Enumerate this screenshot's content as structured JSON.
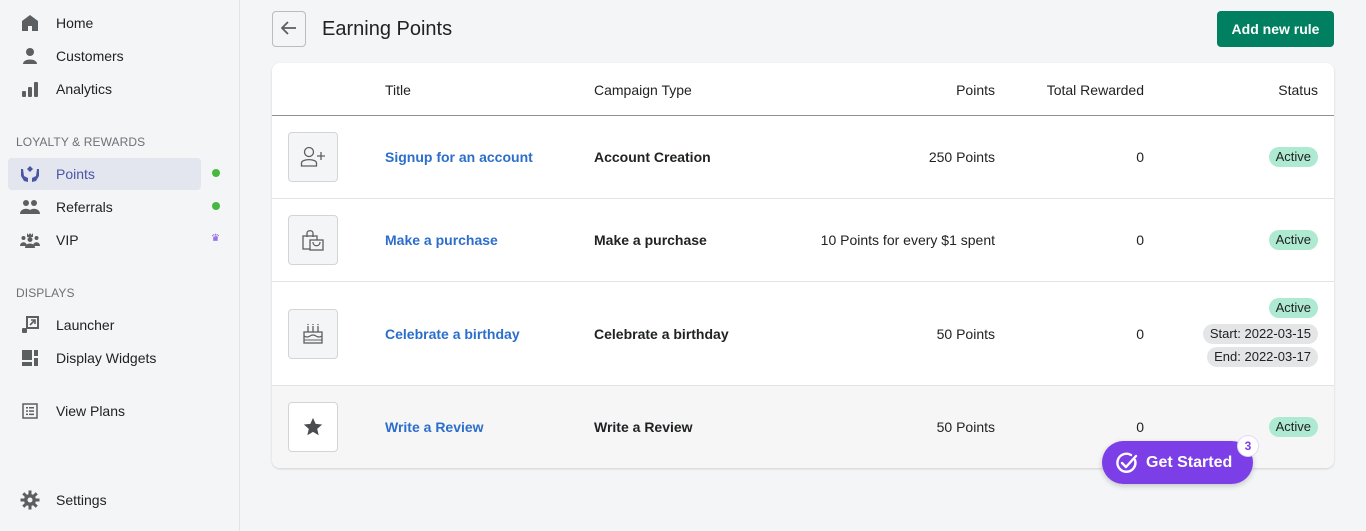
{
  "sidebar": {
    "items_top": [
      {
        "label": "Home",
        "icon": "home-icon"
      },
      {
        "label": "Customers",
        "icon": "person-icon"
      },
      {
        "label": "Analytics",
        "icon": "bar-chart-icon"
      }
    ],
    "section_loyalty": "LOYALTY & REWARDS",
    "items_loyalty": [
      {
        "label": "Points",
        "icon": "hands-heart-icon",
        "active": true,
        "indicator": "green-dot"
      },
      {
        "label": "Referrals",
        "icon": "people-icon",
        "indicator": "green-dot"
      },
      {
        "label": "VIP",
        "icon": "group-crown-icon",
        "indicator": "crown"
      }
    ],
    "section_displays": "DISPLAYS",
    "items_displays": [
      {
        "label": "Launcher",
        "icon": "launcher-icon"
      },
      {
        "label": "Display Widgets",
        "icon": "widgets-icon"
      }
    ],
    "view_plans": {
      "label": "View Plans",
      "icon": "list-icon"
    },
    "settings": {
      "label": "Settings",
      "icon": "gear-icon"
    },
    "crown_glyph": "♛"
  },
  "header": {
    "title": "Earning Points",
    "add_button": "Add new rule"
  },
  "table": {
    "columns": [
      "Title",
      "Campaign Type",
      "Points",
      "Total Rewarded",
      "Status"
    ],
    "rows": [
      {
        "icon": "add-user-icon",
        "title": "Signup for an account",
        "campaign_type": "Account Creation",
        "points": "250 Points",
        "total_rewarded": "0",
        "status": "Active"
      },
      {
        "icon": "shopping-bag-icon",
        "title": "Make a purchase",
        "campaign_type": "Make a purchase",
        "points": "10 Points for every $1 spent",
        "total_rewarded": "0",
        "status": "Active"
      },
      {
        "icon": "birthday-cake-icon",
        "title": "Celebrate a birthday",
        "campaign_type": "Celebrate a birthday",
        "points": "50 Points",
        "total_rewarded": "0",
        "status": "Active",
        "start": "Start: 2022-03-15",
        "end": "End: 2022-03-17"
      },
      {
        "icon": "star-icon",
        "title": "Write a Review",
        "campaign_type": "Write a Review",
        "points": "50 Points",
        "total_rewarded": "0",
        "status": "Active"
      }
    ]
  },
  "get_started": {
    "label": "Get Started",
    "count": "3"
  },
  "colors": {
    "primary_green": "#008060",
    "link_blue": "#2c6ecb",
    "active_badge": "#aee9d1",
    "purple": "#7c3ee6",
    "nav_active": "#4b55a8",
    "indicator_green": "#46b840"
  }
}
